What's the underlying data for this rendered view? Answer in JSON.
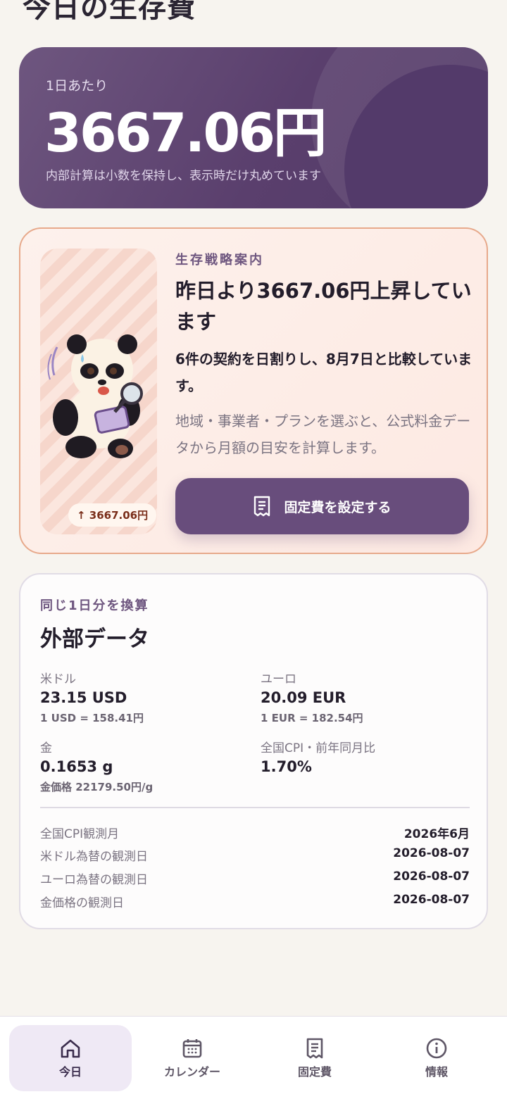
{
  "page": {
    "title": "今日の生存費"
  },
  "hero": {
    "label": "1日あたり",
    "amount": "3667.06円",
    "note": "内部計算は小数を保持し、表示時だけ丸めています"
  },
  "strategy": {
    "kicker": "生存戦略案内",
    "headline": "昨日より3667.06円上昇しています",
    "body": "6件の契約を日割りし、8月7日と比較しています。",
    "sub": "地域・事業者・プランを選ぶと、公式料金データから月額の目安を計算します。",
    "badge": "↑ 3667.06円",
    "button_label": "固定費を設定する",
    "button_icon": "receipt-icon"
  },
  "external": {
    "kicker": "同じ1日分を換算",
    "title": "外部データ",
    "metrics": [
      {
        "label": "米ドル",
        "value": "23.15 USD",
        "sub": "1 USD = 158.41円"
      },
      {
        "label": "ユーロ",
        "value": "20.09 EUR",
        "sub": "1 EUR = 182.54円"
      },
      {
        "label": "金",
        "value": "0.1653 g",
        "sub": "金価格 22179.50円/g"
      },
      {
        "label": "全国CPI・前年同月比",
        "value": "1.70%",
        "sub": ""
      }
    ],
    "observations": [
      {
        "label": "全国CPI観測月",
        "value": "2026年6月"
      },
      {
        "label": "米ドル為替の観測日",
        "value": "2026-08-07"
      },
      {
        "label": "ユーロ為替の観測日",
        "value": "2026-08-07"
      },
      {
        "label": "金価格の観測日",
        "value": "2026-08-07"
      }
    ]
  },
  "nav": [
    {
      "label": "今日",
      "icon": "home-icon",
      "active": true
    },
    {
      "label": "カレンダー",
      "icon": "calendar-icon",
      "active": false
    },
    {
      "label": "固定費",
      "icon": "receipt-icon",
      "active": false
    },
    {
      "label": "情報",
      "icon": "info-icon",
      "active": false
    }
  ],
  "colors": {
    "accent": "#684d7c",
    "hero_bg": "#5a3f6d",
    "strategy_border": "#e7a98b",
    "background": "#f7f4ef"
  }
}
